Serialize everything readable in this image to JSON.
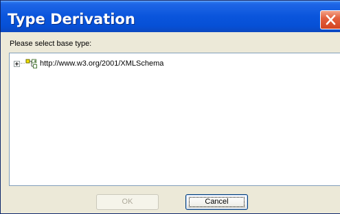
{
  "window": {
    "title": "Type Derivation",
    "close_icon": "close-icon"
  },
  "dialog": {
    "prompt": "Please select base type:"
  },
  "tree": {
    "items": [
      {
        "label": "http://www.w3.org/2001/XMLSchema",
        "icon": "schema-namespace-icon",
        "expanded": false
      }
    ]
  },
  "buttons": {
    "ok_label": "OK",
    "ok_enabled": false,
    "cancel_label": "Cancel"
  },
  "colors": {
    "titlebar": "#0a55dc",
    "close_button": "#e3603e",
    "dialog_bg": "#ece9d8",
    "disabled_text": "#aca899"
  }
}
